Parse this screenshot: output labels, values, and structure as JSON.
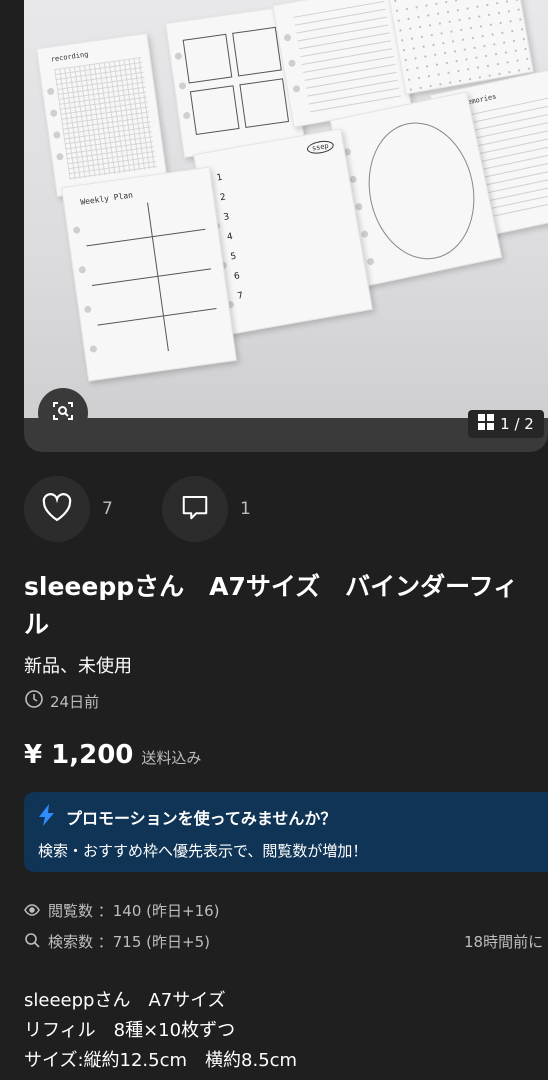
{
  "photo": {
    "sheet_labels": {
      "recording": "recording",
      "weekly_plan": "Weekly Plan",
      "ssep": "ssep",
      "memories": "memories",
      "numbers": [
        "1",
        "2",
        "3",
        "4",
        "5",
        "6",
        "7"
      ]
    },
    "counter": {
      "current": "1",
      "total": "2",
      "text": "1 / 2"
    }
  },
  "actions": {
    "like_count": "7",
    "comment_count": "1"
  },
  "listing": {
    "title": "sleeeppさん　A7サイズ　バインダーフィル",
    "condition": "新品、未使用",
    "posted": "24日前",
    "price": "¥ 1,200",
    "shipping": "送料込み"
  },
  "promo": {
    "heading": "プロモーションを使ってみませんか？",
    "subtext": "検索・おすすめ枠へ優先表示で、閲覧数が増加！",
    "accent": "#0f3456",
    "icon_color": "#2f8cff"
  },
  "stats": {
    "views": "閲覧数 ：140 (昨日+16)",
    "searches": "検索数 ：715 (昨日+5)",
    "updated": "18時間前に"
  },
  "description": {
    "line1": "sleeeppさん　A7サイズ",
    "line2": "リフィル　8種×10枚ずつ",
    "line3": "サイズ:縦約12.5cm　横約8.5cm"
  },
  "icons": [
    "lens-icon",
    "gallery-grid-icon",
    "heart-icon",
    "comment-icon",
    "clock-icon",
    "lightning-icon",
    "eye-icon",
    "search-icon"
  ]
}
